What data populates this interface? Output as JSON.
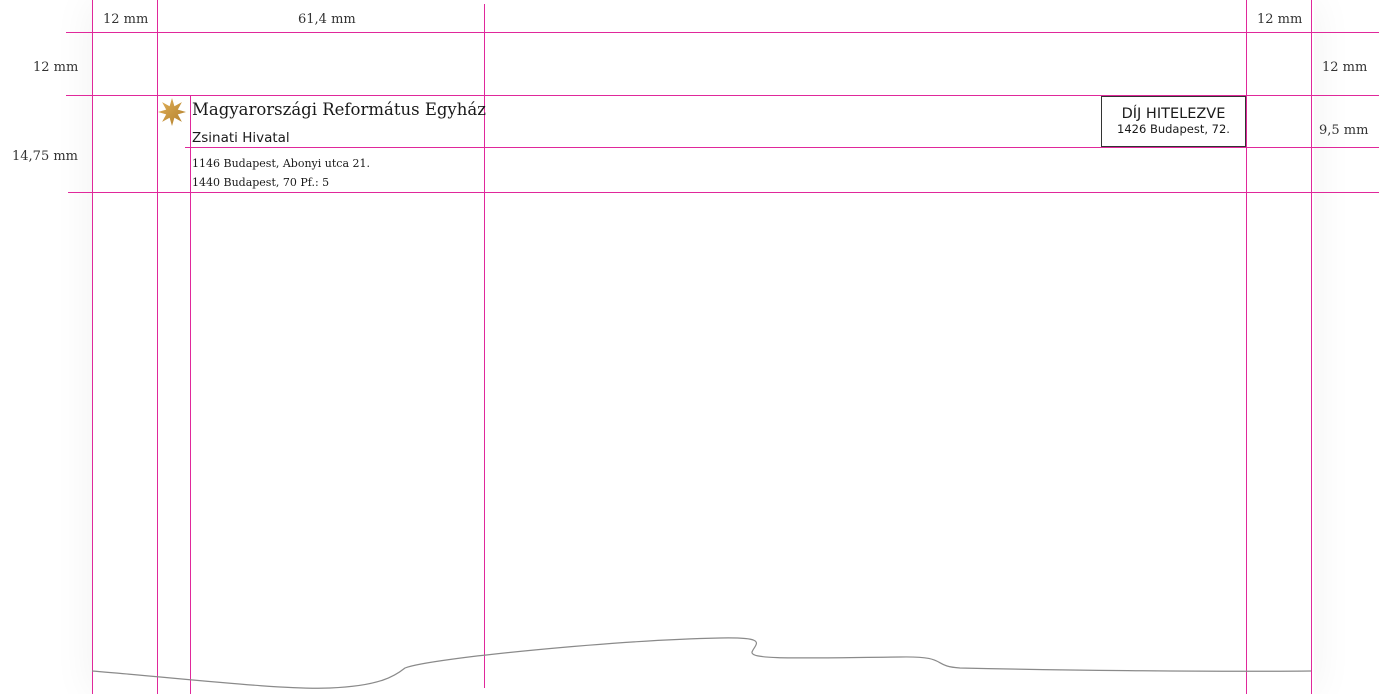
{
  "dimensions": {
    "left_margin": "12 mm",
    "logo_width": "61,4 mm",
    "right_margin": "12 mm",
    "top_margin": "12 mm",
    "top_margin_right": "12 mm",
    "header_height": "14,75 mm",
    "stamp_height": "9,5 mm"
  },
  "letterhead": {
    "organization": "Magyarországi Református Egyház",
    "department": "Zsinati Hivatal",
    "address_line_1": "1146 Budapest, Abonyi utca 21.",
    "address_line_2": "1440 Budapest, 70 Pf.: 5",
    "logo_icon": "star-icon"
  },
  "postage": {
    "title": "DÍJ HITELEZVE",
    "subtitle": "1426 Budapest, 72."
  },
  "colors": {
    "guide": "#e0289b",
    "logo_gold": "#c9973a",
    "text": "#1a1a1a"
  }
}
